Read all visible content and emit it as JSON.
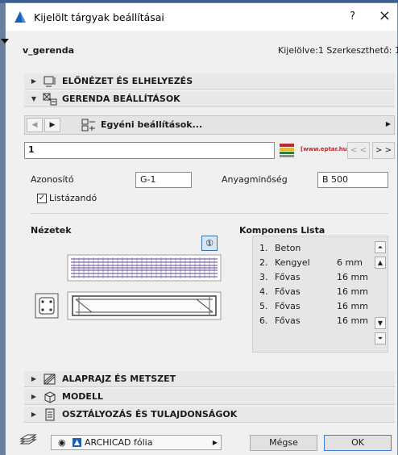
{
  "window": {
    "title": "Kijelölt tárgyak beállításai",
    "help": "?",
    "close": "×"
  },
  "object": {
    "name": "v_gerenda",
    "status": "Kijelölve:1 Szerkeszthető: 1"
  },
  "sections": {
    "preview": "ELŐNÉZET ÉS ELHELYEZÉS",
    "beam": "GERENDA BEÁLLÍTÁSOK",
    "plan": "ALAPRAJZ ÉS METSZET",
    "model": "MODELL",
    "classification": "OSZTÁLYOZÁS ÉS TULAJDONSÁGOK"
  },
  "settings_bar": {
    "label": "Egyéni beállítások..."
  },
  "input_row": {
    "value": "1",
    "logo_url": "[www.eptar.hu]",
    "prev": "< <",
    "next": "> >"
  },
  "fields": {
    "id_label": "Azonosító",
    "id_value": "G-1",
    "material_label": "Anyagminőség",
    "material_value": "B 500",
    "listable_label": "Listázandó",
    "listable_checked": true
  },
  "views": {
    "heading": "Nézetek",
    "marker": "①"
  },
  "components": {
    "heading": "Komponens Lista",
    "rows": [
      {
        "index": "1.",
        "name": "Beton",
        "size": ""
      },
      {
        "index": "2.",
        "name": "Kengyel",
        "size": "6 mm"
      },
      {
        "index": "3.",
        "name": "Fővas",
        "size": "16 mm"
      },
      {
        "index": "4.",
        "name": "Fővas",
        "size": "16 mm"
      },
      {
        "index": "5.",
        "name": "Fővas",
        "size": "16 mm"
      },
      {
        "index": "6.",
        "name": "Fővas",
        "size": "16 mm"
      }
    ]
  },
  "footer": {
    "layer": "ARCHICAD fólia",
    "cancel": "Mégse",
    "ok": "OK"
  },
  "colors": {
    "accent": "#3c7fd6",
    "logo_red": "#c2252a",
    "rebar": "#5a3f8f"
  }
}
